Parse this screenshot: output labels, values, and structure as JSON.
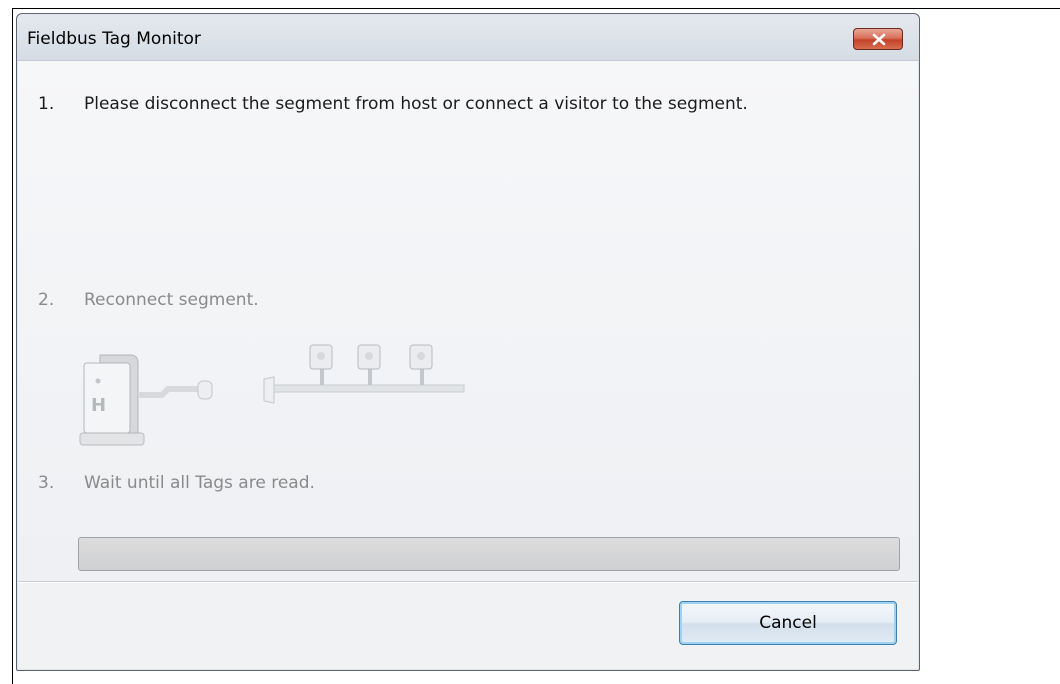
{
  "window": {
    "title": "Fieldbus Tag Monitor",
    "close_icon": "close-icon"
  },
  "steps": [
    {
      "number": "1.",
      "text": "Please disconnect the segment from host or connect a visitor to the segment."
    },
    {
      "number": "2.",
      "text": "Reconnect segment."
    },
    {
      "number": "3.",
      "text": "Wait until all Tags are read."
    }
  ],
  "illustration": {
    "host_label": "H",
    "device_count": 3
  },
  "progress": {
    "value_percent": 0
  },
  "buttons": {
    "cancel_label": "Cancel"
  },
  "colors": {
    "close_button": "#c5412a",
    "cancel_focus": "#3c7fb1"
  }
}
